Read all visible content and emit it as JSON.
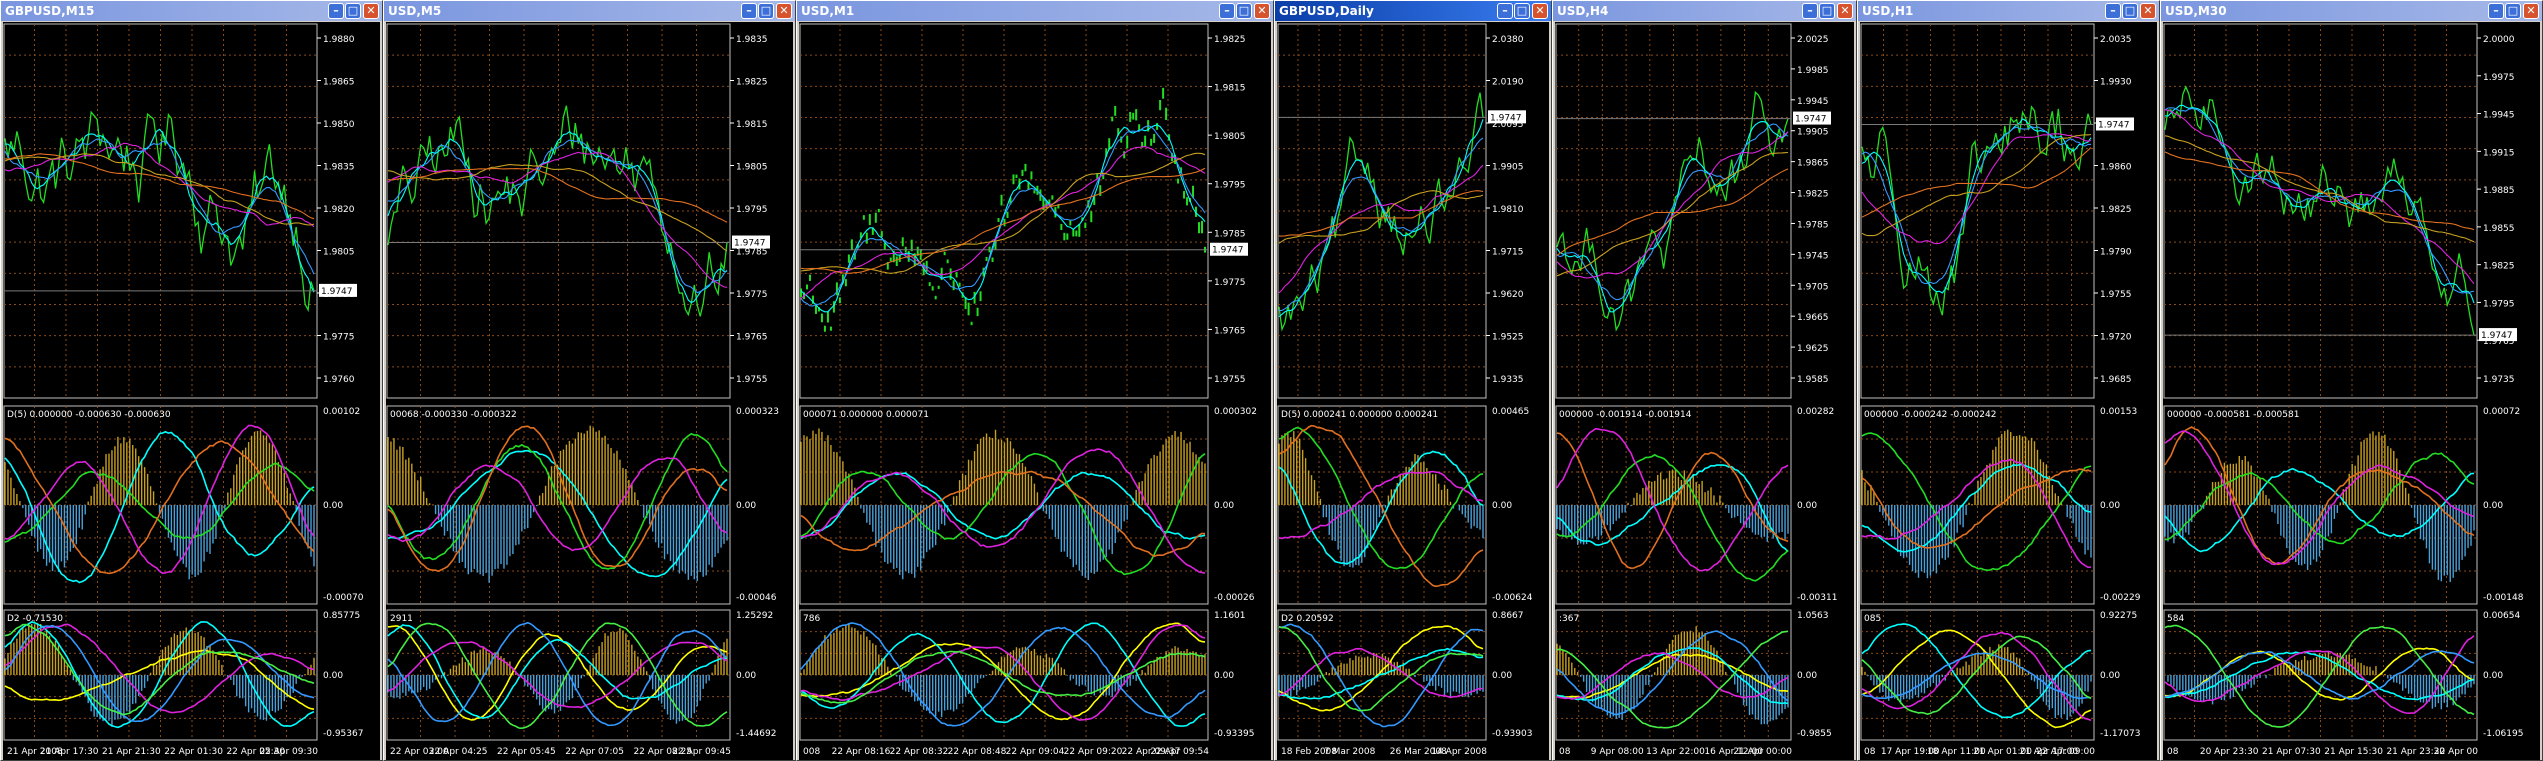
{
  "colors": {
    "bg": "#000000",
    "grid": "#8a4b1a",
    "axis": "#ffffff",
    "green": "#22dd22",
    "cyan": "#00ffff",
    "magenta": "#dd22dd",
    "blue": "#3399ff",
    "orange": "#e07020",
    "gold": "#c8a020",
    "yellow": "#ffff00",
    "red": "#ff3020",
    "steel": "#4aa0d8",
    "lime": "#44ee44"
  },
  "icons": {
    "minimize": "minimize-icon",
    "maximize": "maximize-icon",
    "close": "close-icon"
  },
  "windows": [
    {
      "title": "GBPUSD,M15",
      "active": false,
      "price_ticks": [
        "1.9880",
        "1.9865",
        "1.9850",
        "1.9835",
        "1.9820",
        "1.9805",
        "1.9790",
        "1.9775",
        "1.9760"
      ],
      "current_price": "1.9747",
      "ind1_label": "D(5) 0.000000 -0.000630 -0.000630",
      "ind1_ticks": [
        "0.00102",
        "0.00",
        "-0.00070"
      ],
      "ind2_label": "D2 -0.71530",
      "ind2_ticks": [
        "0.85775",
        "0.00",
        "-0.95367"
      ],
      "time_ticks": [
        "21 Apr 2008",
        "21 Apr 17:30",
        "21 Apr 21:30",
        "22 Apr 01:30",
        "22 Apr 05:30",
        "22 Apr 09:30"
      ]
    },
    {
      "title": "USD,M5",
      "active": false,
      "price_ticks": [
        "1.9835",
        "1.9825",
        "1.9815",
        "1.9805",
        "1.9795",
        "1.9785",
        "1.9775",
        "1.9765",
        "1.9755"
      ],
      "current_price": "1.9747",
      "ind1_label": "00068 -0.000330 -0.000322",
      "ind1_ticks": [
        "0.000323",
        "0.00",
        "-0.00046"
      ],
      "ind2_label": "2911",
      "ind2_ticks": [
        "1.25292",
        "0.00",
        "-1.44692"
      ],
      "time_ticks": [
        "22 Apr 03:00",
        "22 Apr 04:25",
        "22 Apr 05:45",
        "22 Apr 07:05",
        "22 Apr 08:25",
        "22 Apr 09:45"
      ]
    },
    {
      "title": "USD,M1",
      "active": false,
      "price_ticks": [
        "1.9825",
        "1.9815",
        "1.9805",
        "1.9795",
        "1.9785",
        "1.9775",
        "1.9765",
        "1.9755"
      ],
      "current_price": "1.9747",
      "ind1_label": "000071 0.000000 0.000071",
      "ind1_ticks": [
        "0.000302",
        "0.00",
        "-0.00026"
      ],
      "ind2_label": "786",
      "ind2_ticks": [
        "1.1601",
        "0.00",
        "-0.93395"
      ],
      "time_ticks": [
        "008",
        "22 Apr 08:16",
        "22 Apr 08:32",
        "22 Apr 08:48",
        "22 Apr 09:04",
        "22 Apr 09:20",
        "22 Apr 09:37",
        "22 Apr 09:54"
      ]
    },
    {
      "title": "GBPUSD,Daily",
      "active": true,
      "price_ticks": [
        "2.0380",
        "2.0190",
        "2.0095",
        "1.9905",
        "1.9810",
        "1.9715",
        "1.9620",
        "1.9525",
        "1.9335"
      ],
      "current_price": "1.9747",
      "ind1_label": "D(5) 0.000241 0.000000 0.000241",
      "ind1_ticks": [
        "0.00465",
        "0.00",
        "-0.00624"
      ],
      "ind2_label": "D2 0.20592",
      "ind2_ticks": [
        "0.8667",
        "0.00",
        "-0.93903"
      ],
      "time_ticks": [
        "18 Feb 2008",
        "7 Mar 2008",
        "26 Mar 2008",
        "14 Apr 2008"
      ]
    },
    {
      "title": "USD,H4",
      "active": false,
      "price_ticks": [
        "2.0025",
        "1.9985",
        "1.9945",
        "1.9905",
        "1.9865",
        "1.9825",
        "1.9785",
        "1.9745",
        "1.9705",
        "1.9665",
        "1.9625",
        "1.9585"
      ],
      "current_price": "1.9747",
      "ind1_label": "000000 -0.001914 -0.001914",
      "ind1_ticks": [
        "0.00282",
        "0.00",
        "-0.00311"
      ],
      "ind2_label": ":367",
      "ind2_ticks": [
        "1.0563",
        "0.00",
        "-0.9855"
      ],
      "time_ticks": [
        "08",
        "9 Apr 08:00",
        "13 Apr 22:00",
        "16 Apr 12:00",
        "21 Apr 00:00"
      ]
    },
    {
      "title": "USD,H1",
      "active": false,
      "price_ticks": [
        "2.0035",
        "1.9930",
        "1.9895",
        "1.9860",
        "1.9825",
        "1.9790",
        "1.9755",
        "1.9720",
        "1.9685"
      ],
      "current_price": "1.9747",
      "ind1_label": "000000 -0.000242 -0.000242",
      "ind1_ticks": [
        "0.00153",
        "0.00",
        "-0.00229"
      ],
      "ind2_label": "085",
      "ind2_ticks": [
        "0.92275",
        "0.00",
        "-1.17073"
      ],
      "time_ticks": [
        "08",
        "17 Apr 19:00",
        "18 Apr 11:00",
        "21 Apr 01:00",
        "21 Apr 17:00",
        "22 Apr 09:00"
      ]
    },
    {
      "title": "USD,M30",
      "active": false,
      "price_ticks": [
        "2.0000",
        "1.9975",
        "1.9945",
        "1.9915",
        "1.9885",
        "1.9855",
        "1.9825",
        "1.9795",
        "1.9765",
        "1.9735"
      ],
      "current_price": "1.9747",
      "ind1_label": "000000 -0.000581 -0.000581",
      "ind1_ticks": [
        "0.00072",
        "0.00",
        "-0.00148"
      ],
      "ind2_label": "584",
      "ind2_ticks": [
        "0.00654",
        "0.00",
        "-1.06195"
      ],
      "time_ticks": [
        "08",
        "20 Apr 23:30",
        "21 Apr 07:30",
        "21 Apr 15:30",
        "21 Apr 23:30",
        "22 Apr 00"
      ]
    }
  ]
}
